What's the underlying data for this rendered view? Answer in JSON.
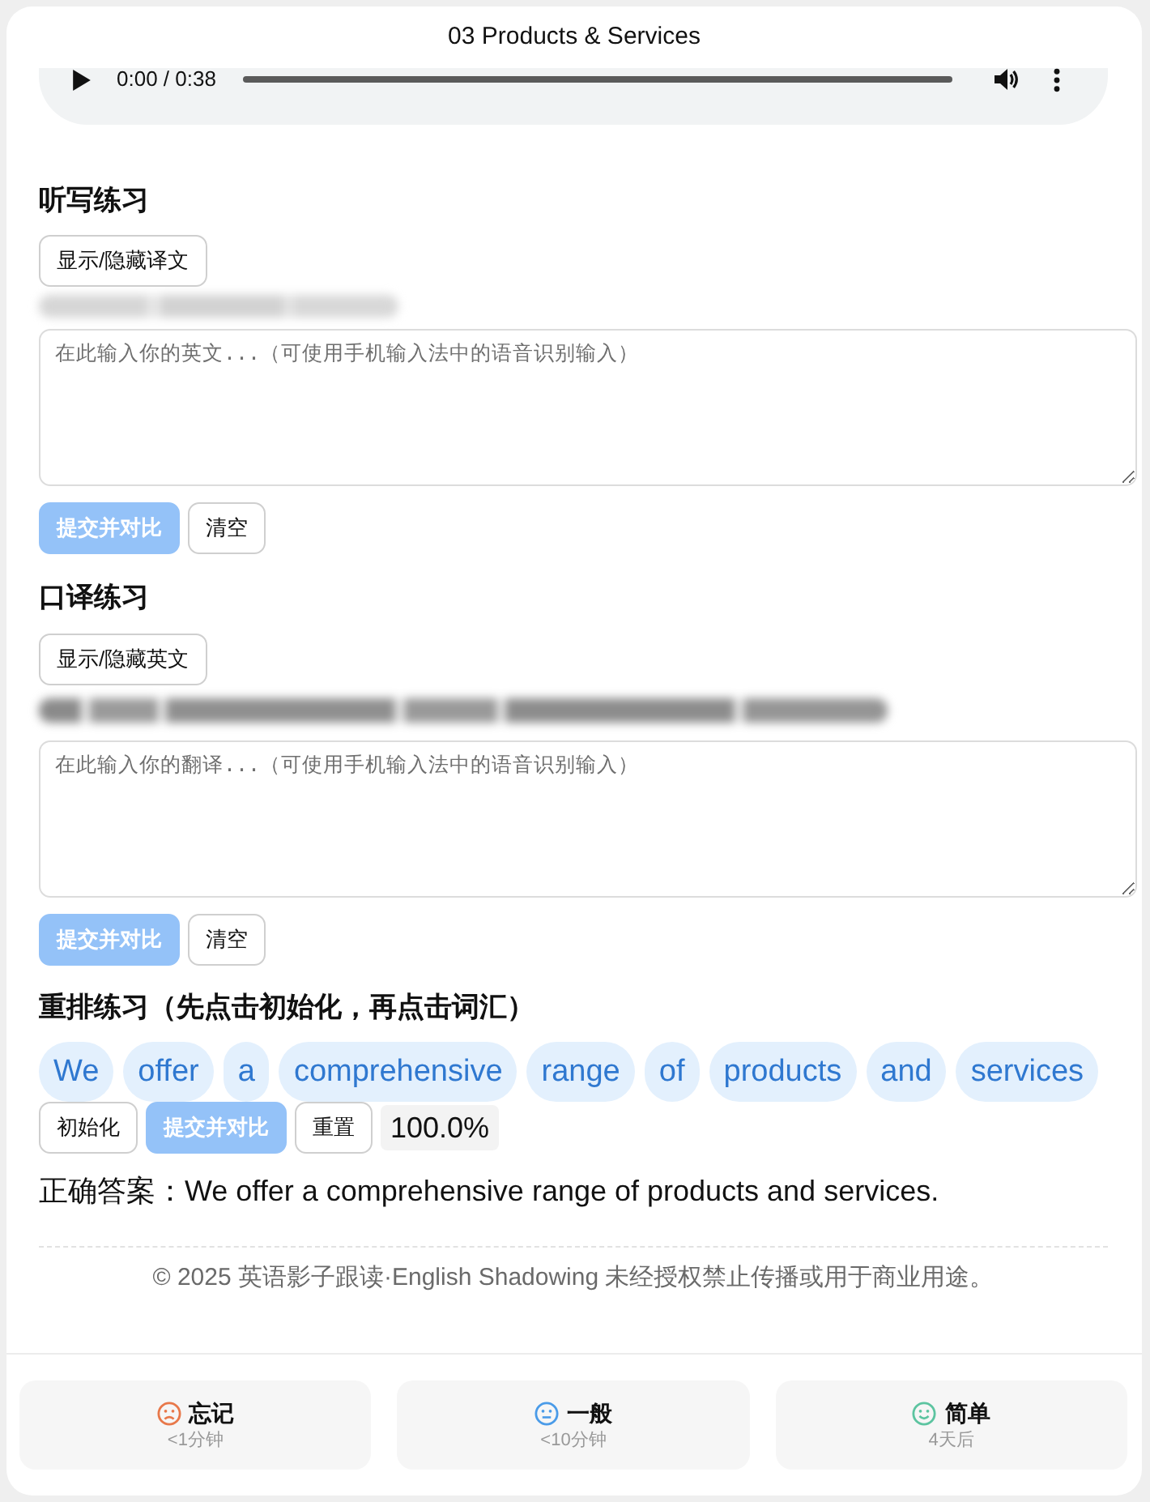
{
  "header": {
    "title": "03 Products & Services"
  },
  "audio_player": {
    "time": "0:00 / 0:38",
    "level": 0
  },
  "dictation": {
    "heading": "听写练习",
    "toggle_button": "显示/隐藏译文",
    "hint_blurred": true,
    "input": {
      "placeholder": "在此输入你的英文...（可使用手机输入法中的语音识别输入）"
    },
    "buttons": [
      {
        "label": "提交并对比",
        "kind": "primary",
        "disabled": true
      },
      {
        "label": "清空",
        "kind": "plain",
        "disabled": false
      }
    ]
  },
  "interpretation": {
    "heading": "口译练习",
    "toggle_button": "显示/隐藏英文",
    "source_blurred": true,
    "input": {
      "placeholder": "在此输入你的翻译...（可使用手机输入法中的语音识别输入）"
    },
    "buttons": [
      {
        "label": "提交并对比",
        "kind": "primary",
        "disabled": true
      },
      {
        "label": "清空",
        "kind": "plain",
        "disabled": false
      }
    ]
  },
  "reorder": {
    "heading": "重排练习（先点击初始化，再点击词汇）",
    "words": [
      "We",
      "offer",
      "a",
      "comprehensive",
      "range",
      "of",
      "products",
      "and",
      "services"
    ],
    "buttons": [
      {
        "label": "初始化",
        "kind": "plain",
        "disabled": false
      },
      {
        "label": "提交并对比",
        "kind": "primary",
        "disabled": true
      },
      {
        "label": "重置",
        "kind": "plain",
        "disabled": false
      }
    ],
    "score": "100.0%",
    "answer": "正确答案：We offer a comprehensive range of products and services."
  },
  "footer": "© 2025 英语影子跟读·English Shadowing 未经授权禁止传播或用于商业用途。",
  "ratings": [
    {
      "label": "忘记",
      "interval": "<1分钟",
      "kind": "sad",
      "color": "#e8784a"
    },
    {
      "label": "一般",
      "interval": "<10分钟",
      "kind": "neutral",
      "color": "#4a9be8"
    },
    {
      "label": "简单",
      "interval": "4天后",
      "kind": "happy",
      "color": "#5cc4a0"
    }
  ]
}
